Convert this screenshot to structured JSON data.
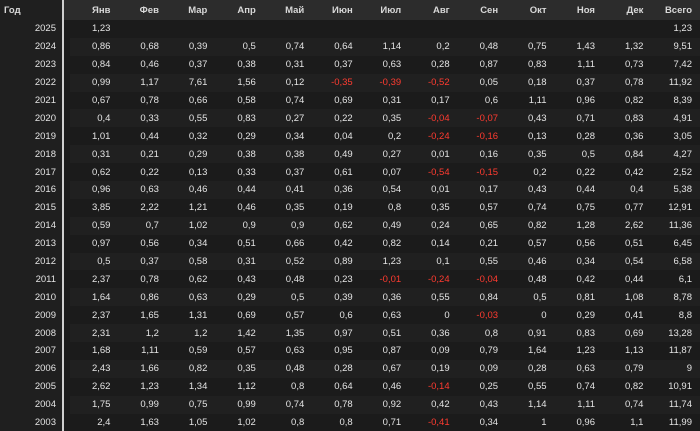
{
  "header": [
    "Год",
    "Янв",
    "Фев",
    "Мар",
    "Апр",
    "Май",
    "Июн",
    "Июл",
    "Авг",
    "Сен",
    "Окт",
    "Ноя",
    "Дек",
    "Всего"
  ],
  "rows": [
    [
      "2025",
      "1,23",
      "",
      "",
      "",
      "",
      "",
      "",
      "",
      "",
      "",
      "",
      "",
      "1,23"
    ],
    [
      "2024",
      "0,86",
      "0,68",
      "0,39",
      "0,5",
      "0,74",
      "0,64",
      "1,14",
      "0,2",
      "0,48",
      "0,75",
      "1,43",
      "1,32",
      "9,51"
    ],
    [
      "2023",
      "0,84",
      "0,46",
      "0,37",
      "0,38",
      "0,31",
      "0,37",
      "0,63",
      "0,28",
      "0,87",
      "0,83",
      "1,11",
      "0,73",
      "7,42"
    ],
    [
      "2022",
      "0,99",
      "1,17",
      "7,61",
      "1,56",
      "0,12",
      "-0,35",
      "-0,39",
      "-0,52",
      "0,05",
      "0,18",
      "0,37",
      "0,78",
      "11,92"
    ],
    [
      "2021",
      "0,67",
      "0,78",
      "0,66",
      "0,58",
      "0,74",
      "0,69",
      "0,31",
      "0,17",
      "0,6",
      "1,11",
      "0,96",
      "0,82",
      "8,39"
    ],
    [
      "2020",
      "0,4",
      "0,33",
      "0,55",
      "0,83",
      "0,27",
      "0,22",
      "0,35",
      "-0,04",
      "-0,07",
      "0,43",
      "0,71",
      "0,83",
      "4,91"
    ],
    [
      "2019",
      "1,01",
      "0,44",
      "0,32",
      "0,29",
      "0,34",
      "0,04",
      "0,2",
      "-0,24",
      "-0,16",
      "0,13",
      "0,28",
      "0,36",
      "3,05"
    ],
    [
      "2018",
      "0,31",
      "0,21",
      "0,29",
      "0,38",
      "0,38",
      "0,49",
      "0,27",
      "0,01",
      "0,16",
      "0,35",
      "0,5",
      "0,84",
      "4,27"
    ],
    [
      "2017",
      "0,62",
      "0,22",
      "0,13",
      "0,33",
      "0,37",
      "0,61",
      "0,07",
      "-0,54",
      "-0,15",
      "0,2",
      "0,22",
      "0,42",
      "2,52"
    ],
    [
      "2016",
      "0,96",
      "0,63",
      "0,46",
      "0,44",
      "0,41",
      "0,36",
      "0,54",
      "0,01",
      "0,17",
      "0,43",
      "0,44",
      "0,4",
      "5,38"
    ],
    [
      "2015",
      "3,85",
      "2,22",
      "1,21",
      "0,46",
      "0,35",
      "0,19",
      "0,8",
      "0,35",
      "0,57",
      "0,74",
      "0,75",
      "0,77",
      "12,91"
    ],
    [
      "2014",
      "0,59",
      "0,7",
      "1,02",
      "0,9",
      "0,9",
      "0,62",
      "0,49",
      "0,24",
      "0,65",
      "0,82",
      "1,28",
      "2,62",
      "11,36"
    ],
    [
      "2013",
      "0,97",
      "0,56",
      "0,34",
      "0,51",
      "0,66",
      "0,42",
      "0,82",
      "0,14",
      "0,21",
      "0,57",
      "0,56",
      "0,51",
      "6,45"
    ],
    [
      "2012",
      "0,5",
      "0,37",
      "0,58",
      "0,31",
      "0,52",
      "0,89",
      "1,23",
      "0,1",
      "0,55",
      "0,46",
      "0,34",
      "0,54",
      "6,58"
    ],
    [
      "2011",
      "2,37",
      "0,78",
      "0,62",
      "0,43",
      "0,48",
      "0,23",
      "-0,01",
      "-0,24",
      "-0,04",
      "0,48",
      "0,42",
      "0,44",
      "6,1"
    ],
    [
      "2010",
      "1,64",
      "0,86",
      "0,63",
      "0,29",
      "0,5",
      "0,39",
      "0,36",
      "0,55",
      "0,84",
      "0,5",
      "0,81",
      "1,08",
      "8,78"
    ],
    [
      "2009",
      "2,37",
      "1,65",
      "1,31",
      "0,69",
      "0,57",
      "0,6",
      "0,63",
      "0",
      "-0,03",
      "0",
      "0,29",
      "0,41",
      "8,8"
    ],
    [
      "2008",
      "2,31",
      "1,2",
      "1,2",
      "1,42",
      "1,35",
      "0,97",
      "0,51",
      "0,36",
      "0,8",
      "0,91",
      "0,83",
      "0,69",
      "13,28"
    ],
    [
      "2007",
      "1,68",
      "1,11",
      "0,59",
      "0,57",
      "0,63",
      "0,95",
      "0,87",
      "0,09",
      "0,79",
      "1,64",
      "1,23",
      "1,13",
      "11,87"
    ],
    [
      "2006",
      "2,43",
      "1,66",
      "0,82",
      "0,35",
      "0,48",
      "0,28",
      "0,67",
      "0,19",
      "0,09",
      "0,28",
      "0,63",
      "0,79",
      "9"
    ],
    [
      "2005",
      "2,62",
      "1,23",
      "1,34",
      "1,12",
      "0,8",
      "0,64",
      "0,46",
      "-0,14",
      "0,25",
      "0,55",
      "0,74",
      "0,82",
      "10,91"
    ],
    [
      "2004",
      "1,75",
      "0,99",
      "0,75",
      "0,99",
      "0,74",
      "0,78",
      "0,92",
      "0,42",
      "0,43",
      "1,14",
      "1,11",
      "0,74",
      "11,74"
    ],
    [
      "2003",
      "2,4",
      "1,63",
      "1,05",
      "1,02",
      "0,8",
      "0,8",
      "0,71",
      "-0,41",
      "0,34",
      "1",
      "0,96",
      "1,1",
      "11,99"
    ]
  ]
}
